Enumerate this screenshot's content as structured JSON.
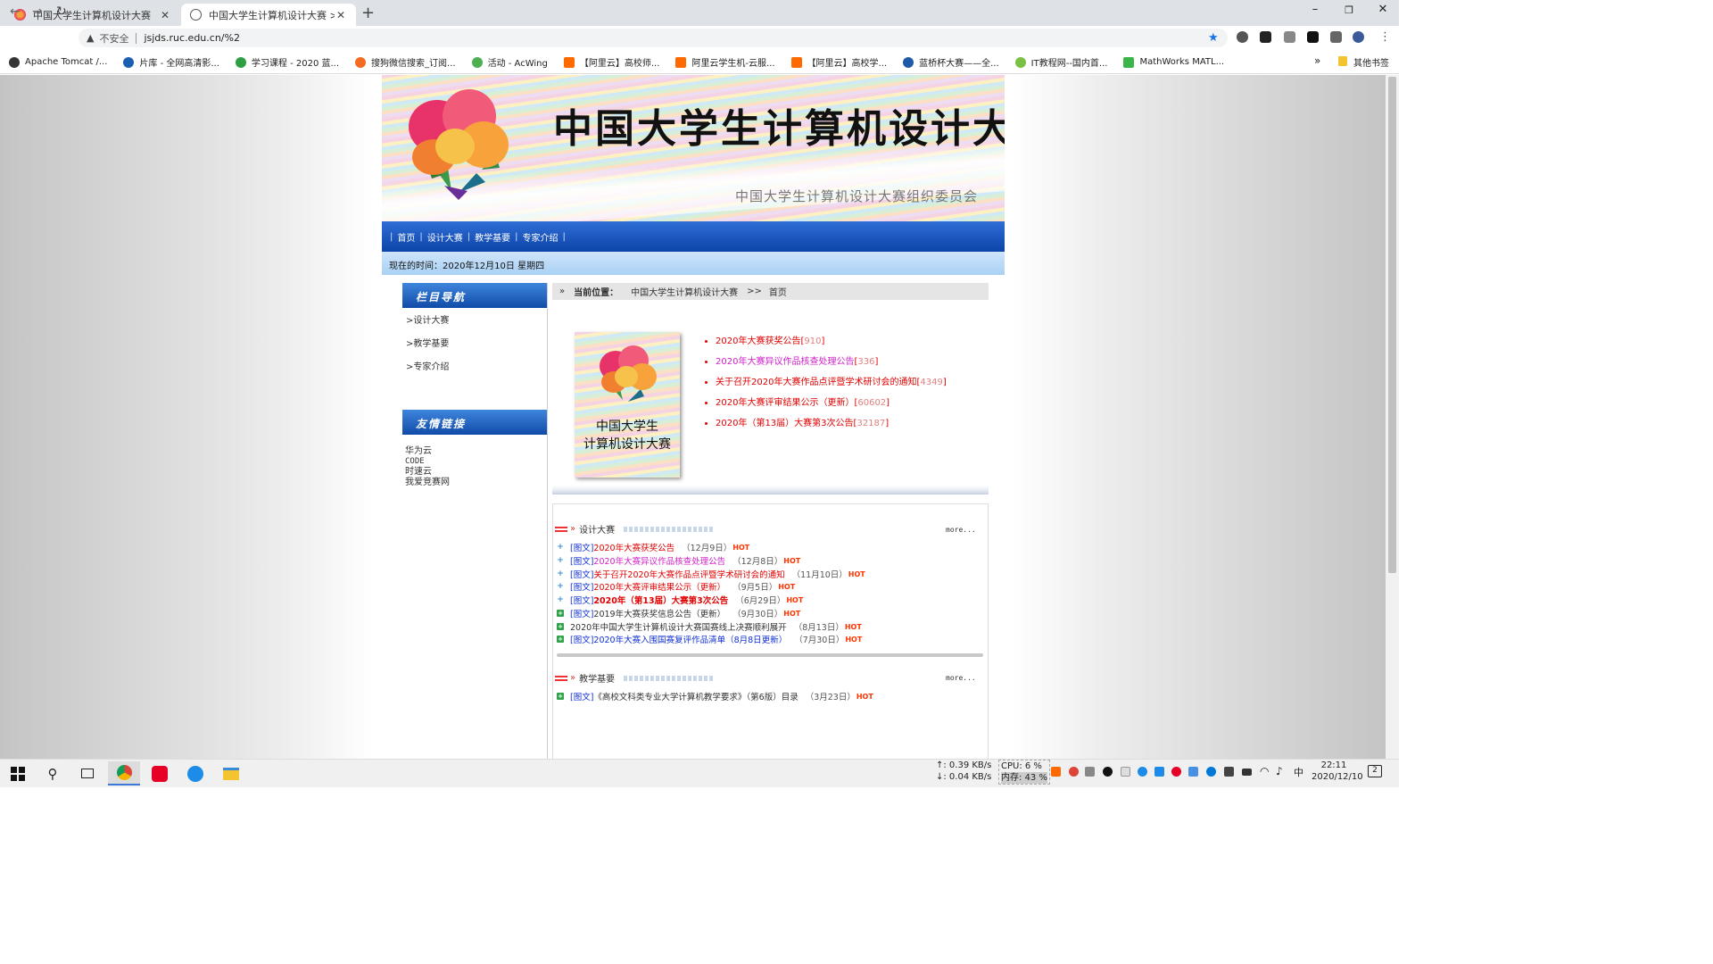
{
  "browser": {
    "tabs": [
      {
        "title": "中国大学生计算机设计大赛"
      },
      {
        "title": "中国大学生计算机设计大赛 >> 首页"
      }
    ],
    "new_tab": "+",
    "window_controls": {
      "min": "–",
      "max": "❐",
      "close": "✕"
    },
    "address": {
      "security_label": "不安全",
      "url": "jsjds.ruc.edu.cn/%2"
    },
    "bookmarks": [
      "Apache Tomcat /...",
      "片库 - 全网高清影...",
      "学习课程 - 2020 蓝...",
      "搜狗微信搜索_订阅...",
      "活动 - AcWing",
      "【阿里云】高校师...",
      "阿里云学生机-云服...",
      "【阿里云】高校学...",
      "蓝桥杯大赛——全...",
      "IT教程网--国内首...",
      "MathWorks MATL..."
    ],
    "bookmarks_overflow": "»",
    "other_bookmarks": "其他书签",
    "colors": {
      "tab_strip": "#dee1e6",
      "accent": "#1a73e8"
    }
  },
  "site": {
    "banner_title": "中国大学生计算机设计大赛",
    "banner_org": "中国大学生计算机设计大赛组织委员会",
    "nav": [
      "首页",
      "设计大赛",
      "教学基要",
      "专家介绍"
    ],
    "nav_sep": "|",
    "time_text": "现在的时间：2020年12月10日  星期四",
    "sidebar": {
      "nav_title": "栏目导航",
      "nav_items": [
        ">设计大赛",
        ">教学基要",
        ">专家介绍"
      ],
      "links_title": "友情链接",
      "links": [
        "华为云",
        "CODE",
        "时速云",
        "我爱竞赛网"
      ]
    },
    "breadcrumb": {
      "icon": "»",
      "label": "当前位置：",
      "site": "中国大学生计算机设计大赛",
      "sep": ">>",
      "page": "首页"
    },
    "cover_text": [
      "中国大学生",
      "计算机设计大赛"
    ],
    "top_news": [
      {
        "title": "2020年大赛获奖公告",
        "count": "910",
        "color": "red"
      },
      {
        "title": "2020年大赛异议作品核查处理公告",
        "count": "336",
        "color": "magenta"
      },
      {
        "title": "关于召开2020年大赛作品点评暨学术研讨会的通知",
        "count": "4349",
        "color": "red"
      },
      {
        "title": "2020年大赛评审结果公示（更新）",
        "count": "60602",
        "color": "red"
      },
      {
        "title": "2020年（第13届）大赛第3次公告",
        "count": "32187",
        "color": "red"
      }
    ],
    "sections": [
      {
        "title": "设计大赛",
        "more": "more...",
        "items": [
          {
            "tag": "[图文]",
            "title": "2020年大赛获奖公告",
            "date": "（12月9日）",
            "hot": "HOT"
          },
          {
            "tag": "[图文]",
            "title": "2020年大赛异议作品核查处理公告",
            "date": "（12月8日）",
            "hot": "HOT"
          },
          {
            "tag": "[图文]",
            "title": "关于召开2020年大赛作品点评暨学术研讨会的通知",
            "date": "（11月10日）",
            "hot": "HOT"
          },
          {
            "tag": "[图文]",
            "title": "2020年大赛评审结果公示（更新）",
            "date": "（9月5日）",
            "hot": "HOT"
          },
          {
            "tag": "[图文]",
            "title": "2020年（第13届）大赛第3次公告",
            "date": "（6月29日）",
            "hot": "HOT"
          },
          {
            "tag": "[图文]",
            "title": "2019年大赛获奖信息公告（更新）",
            "date": "（9月30日）",
            "hot": "HOT"
          },
          {
            "tag": "",
            "title": "2020年中国大学生计算机设计大赛国赛线上决赛顺利展开",
            "date": "（8月13日）",
            "hot": "HOT"
          },
          {
            "tag": "[图文]",
            "title": "2020年大赛入围国赛复评作品清单（8月8日更新）",
            "date": "（7月30日）",
            "hot": "HOT"
          }
        ]
      },
      {
        "title": "教学基要",
        "more": "more...",
        "items": [
          {
            "tag": "[图文]",
            "title": "《高校文科类专业大学计算机教学要求》（第6版）目录",
            "date": "（3月23日）",
            "hot": "HOT"
          }
        ]
      }
    ]
  },
  "taskbar": {
    "net_up": "↑: 0.39 KB/s",
    "net_down": "↓: 0.04 KB/s",
    "cpu": "CPU: 6 %",
    "mem": "内存: 43 %",
    "ime": "中",
    "time": "22:11",
    "date": "2020/12/10",
    "notif": "2"
  }
}
